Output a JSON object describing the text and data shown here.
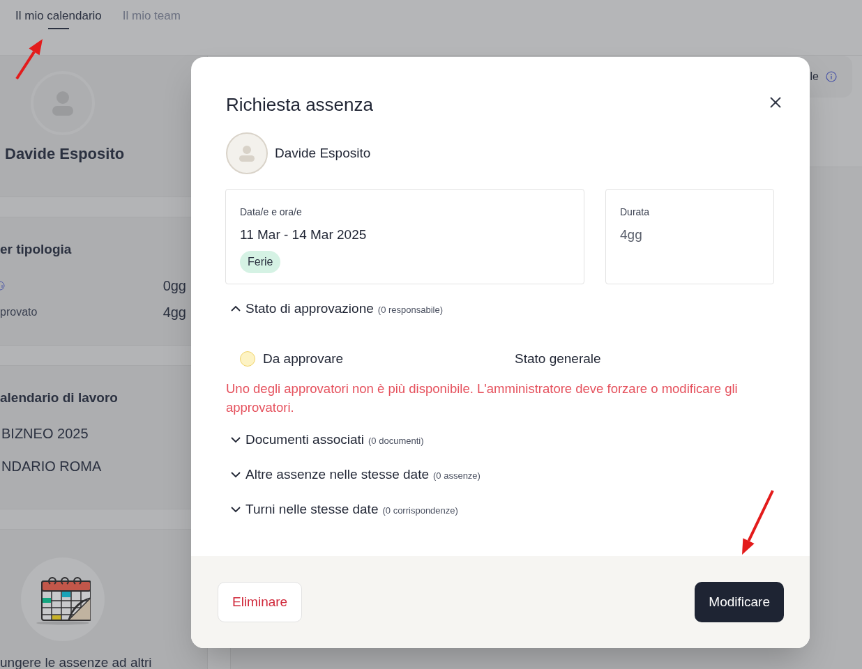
{
  "tabs": [
    {
      "label": "Il mio calendario",
      "selected": true
    },
    {
      "label": "Il mio team",
      "selected": false
    }
  ],
  "profile": {
    "name": "Davide Esposito"
  },
  "by_type": {
    "title": "er tipologia",
    "rows": [
      {
        "kind": "info",
        "value": "0gg"
      },
      {
        "kind": "text",
        "label": "provato",
        "value": "4gg"
      }
    ]
  },
  "work_calendar": {
    "title": "alendario di lavoro",
    "items": [
      "BIZNEO 2025",
      "NDARIO ROMA"
    ]
  },
  "promo": {
    "text": "ungere le assenze ad altri"
  },
  "top_right_card": {
    "text": "le"
  },
  "modal": {
    "title": "Richiesta assenza",
    "employee": "Davide Esposito",
    "dates": {
      "label": "Data/e e ora/e",
      "value": "11 Mar - 14 Mar 2025",
      "badge": {
        "label": "Ferie",
        "color": "#d5f2e4"
      }
    },
    "duration": {
      "label": "Durata",
      "value": "4gg"
    },
    "sections": [
      {
        "title": "Stato di approvazione",
        "count": "(0 responsabile)",
        "expanded": true,
        "content": {
          "status": "Da approvare",
          "color": "#fdf3c4",
          "overall": "Stato generale",
          "warning": "Uno degli approvatori non è più disponibile. L'amministratore deve forzare o modificare gli approvatori."
        }
      },
      {
        "title": "Documenti associati",
        "count": "(0 documenti)",
        "expanded": false
      },
      {
        "title": "Altre assenze nelle stesse date",
        "count": "(0 assenze)",
        "expanded": false
      },
      {
        "title": "Turni nelle stesse date",
        "count": "(0 corrispondenze)",
        "expanded": false
      }
    ],
    "buttons": [
      {
        "label": "Eliminare",
        "kind": "danger"
      },
      {
        "label": "Modificare",
        "kind": "primary"
      }
    ]
  }
}
